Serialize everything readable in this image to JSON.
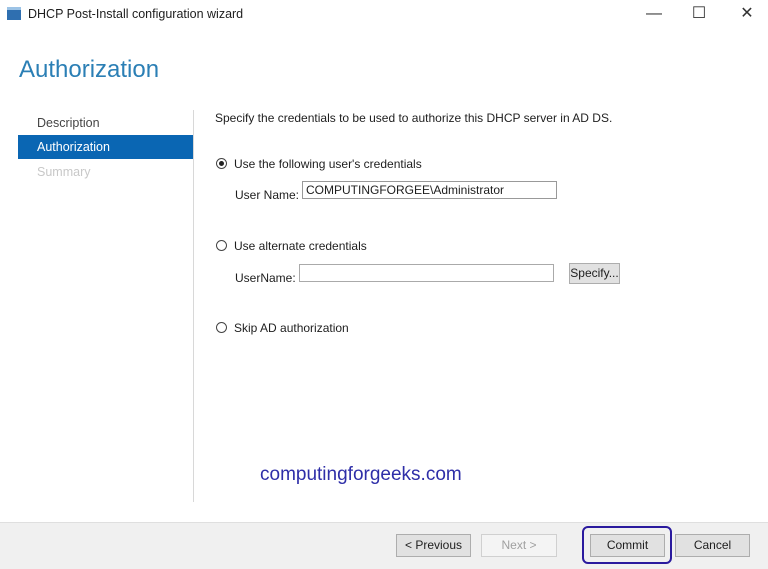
{
  "window": {
    "title": "DHCP Post-Install configuration wizard",
    "minimize": "—",
    "maximize": "☐",
    "close": "✕"
  },
  "page": {
    "heading": "Authorization"
  },
  "nav": [
    {
      "label": "Description"
    },
    {
      "label": "Authorization"
    },
    {
      "label": "Summary"
    }
  ],
  "main": {
    "intro": "Specify the credentials to be used to authorize this DHCP server in AD DS.",
    "option1": {
      "label": "Use the following user's credentials",
      "field_label": "User Name:",
      "value": "COMPUTINGFORGEE\\Administrator"
    },
    "option2": {
      "label": "Use alternate credentials",
      "field_label": "UserName:",
      "value": "",
      "specify": "Specify..."
    },
    "option3": {
      "label": "Skip AD authorization"
    }
  },
  "watermark": "computingforgeeks.com",
  "footer": {
    "previous": "< Previous",
    "next": "Next >",
    "commit": "Commit",
    "cancel": "Cancel"
  }
}
